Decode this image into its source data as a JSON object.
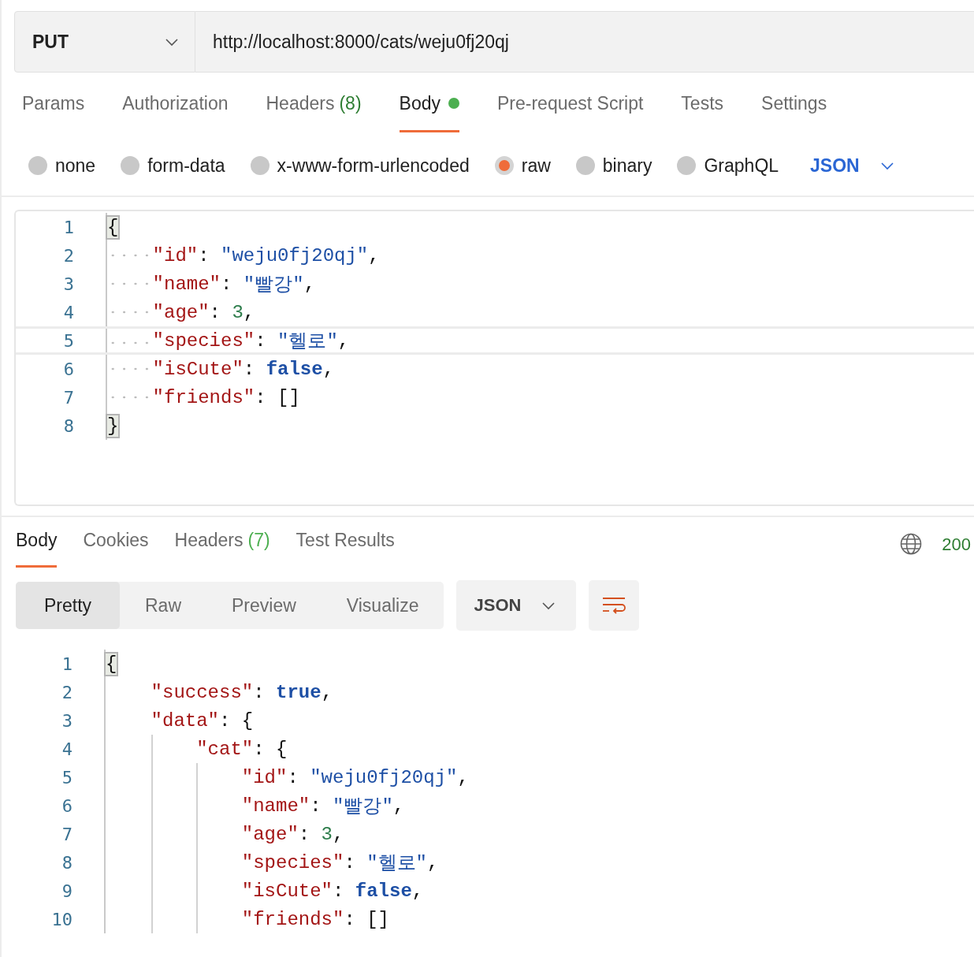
{
  "request": {
    "method": "PUT",
    "url": "http://localhost:8000/cats/weju0fj20qj",
    "tabs": [
      {
        "label": "Params",
        "selected": false,
        "indicator": false
      },
      {
        "label": "Authorization",
        "selected": false,
        "indicator": false
      },
      {
        "label": "Headers",
        "count": "(8)",
        "selected": false,
        "indicator": false
      },
      {
        "label": "Body",
        "selected": true,
        "indicator": true
      },
      {
        "label": "Pre-request Script",
        "selected": false,
        "indicator": false
      },
      {
        "label": "Tests",
        "selected": false,
        "indicator": false
      },
      {
        "label": "Settings",
        "selected": false,
        "indicator": false
      }
    ],
    "body_types": [
      {
        "label": "none",
        "selected": false
      },
      {
        "label": "form-data",
        "selected": false
      },
      {
        "label": "x-www-form-urlencoded",
        "selected": false
      },
      {
        "label": "raw",
        "selected": true
      },
      {
        "label": "binary",
        "selected": false
      },
      {
        "label": "GraphQL",
        "selected": false
      }
    ],
    "raw_format": "JSON",
    "editor": {
      "show_whitespace": true,
      "lines": [
        {
          "number": "1",
          "active": false,
          "tokens": [
            {
              "kind": "brace_match",
              "text": "{"
            }
          ],
          "children": [
            {
              "number": "2",
              "active": false,
              "tokens": [
                {
                  "kind": "key",
                  "text": "\"id\""
                },
                {
                  "kind": "punct",
                  "text": ": "
                },
                {
                  "kind": "string",
                  "text": "\"weju0fj20qj\""
                },
                {
                  "kind": "punct",
                  "text": ","
                }
              ]
            },
            {
              "number": "3",
              "active": false,
              "tokens": [
                {
                  "kind": "key",
                  "text": "\"name\""
                },
                {
                  "kind": "punct",
                  "text": ": "
                },
                {
                  "kind": "string",
                  "text": "\"빨강\""
                },
                {
                  "kind": "punct",
                  "text": ","
                }
              ]
            },
            {
              "number": "4",
              "active": false,
              "tokens": [
                {
                  "kind": "key",
                  "text": "\"age\""
                },
                {
                  "kind": "punct",
                  "text": ": "
                },
                {
                  "kind": "number",
                  "text": "3"
                },
                {
                  "kind": "punct",
                  "text": ","
                }
              ]
            },
            {
              "number": "5",
              "active": true,
              "tokens": [
                {
                  "kind": "key",
                  "text": "\"species\""
                },
                {
                  "kind": "punct",
                  "text": ": "
                },
                {
                  "kind": "string",
                  "text": "\"헬로\""
                },
                {
                  "kind": "punct",
                  "text": ","
                }
              ]
            },
            {
              "number": "6",
              "active": false,
              "tokens": [
                {
                  "kind": "key",
                  "text": "\"isCute\""
                },
                {
                  "kind": "punct",
                  "text": ": "
                },
                {
                  "kind": "bool",
                  "text": "false"
                },
                {
                  "kind": "punct",
                  "text": ","
                }
              ]
            },
            {
              "number": "7",
              "active": false,
              "tokens": [
                {
                  "kind": "key",
                  "text": "\"friends\""
                },
                {
                  "kind": "punct",
                  "text": ": "
                },
                {
                  "kind": "punct",
                  "text": "[]"
                }
              ]
            }
          ]
        },
        {
          "number": "8",
          "active": false,
          "tokens": [
            {
              "kind": "brace_match",
              "text": "}"
            }
          ]
        }
      ]
    }
  },
  "response": {
    "tabs": [
      {
        "label": "Body",
        "selected": true
      },
      {
        "label": "Cookies",
        "selected": false
      },
      {
        "label": "Headers",
        "count": "(7)",
        "selected": false
      },
      {
        "label": "Test Results",
        "selected": false
      }
    ],
    "status": "200",
    "views": [
      {
        "label": "Pretty",
        "selected": true
      },
      {
        "label": "Raw",
        "selected": false
      },
      {
        "label": "Preview",
        "selected": false
      },
      {
        "label": "Visualize",
        "selected": false
      }
    ],
    "format": "JSON",
    "editor": {
      "lines": [
        {
          "number": "1",
          "tokens": [
            {
              "kind": "brace_match",
              "text": "{"
            }
          ],
          "children": [
            {
              "number": "2",
              "tokens": [
                {
                  "kind": "key",
                  "text": "\"success\""
                },
                {
                  "kind": "punct",
                  "text": ": "
                },
                {
                  "kind": "bool",
                  "text": "true"
                },
                {
                  "kind": "punct",
                  "text": ","
                }
              ]
            },
            {
              "number": "3",
              "tokens": [
                {
                  "kind": "key",
                  "text": "\"data\""
                },
                {
                  "kind": "punct",
                  "text": ": {"
                }
              ],
              "children": [
                {
                  "number": "4",
                  "tokens": [
                    {
                      "kind": "key",
                      "text": "\"cat\""
                    },
                    {
                      "kind": "punct",
                      "text": ": {"
                    }
                  ],
                  "children": [
                    {
                      "number": "5",
                      "tokens": [
                        {
                          "kind": "key",
                          "text": "\"id\""
                        },
                        {
                          "kind": "punct",
                          "text": ": "
                        },
                        {
                          "kind": "string",
                          "text": "\"weju0fj20qj\""
                        },
                        {
                          "kind": "punct",
                          "text": ","
                        }
                      ]
                    },
                    {
                      "number": "6",
                      "tokens": [
                        {
                          "kind": "key",
                          "text": "\"name\""
                        },
                        {
                          "kind": "punct",
                          "text": ": "
                        },
                        {
                          "kind": "string",
                          "text": "\"빨강\""
                        },
                        {
                          "kind": "punct",
                          "text": ","
                        }
                      ]
                    },
                    {
                      "number": "7",
                      "tokens": [
                        {
                          "kind": "key",
                          "text": "\"age\""
                        },
                        {
                          "kind": "punct",
                          "text": ": "
                        },
                        {
                          "kind": "number",
                          "text": "3"
                        },
                        {
                          "kind": "punct",
                          "text": ","
                        }
                      ]
                    },
                    {
                      "number": "8",
                      "tokens": [
                        {
                          "kind": "key",
                          "text": "\"species\""
                        },
                        {
                          "kind": "punct",
                          "text": ": "
                        },
                        {
                          "kind": "string",
                          "text": "\"헬로\""
                        },
                        {
                          "kind": "punct",
                          "text": ","
                        }
                      ]
                    },
                    {
                      "number": "9",
                      "tokens": [
                        {
                          "kind": "key",
                          "text": "\"isCute\""
                        },
                        {
                          "kind": "punct",
                          "text": ": "
                        },
                        {
                          "kind": "bool",
                          "text": "false"
                        },
                        {
                          "kind": "punct",
                          "text": ","
                        }
                      ]
                    },
                    {
                      "number": "10",
                      "tokens": [
                        {
                          "kind": "key",
                          "text": "\"friends\""
                        },
                        {
                          "kind": "punct",
                          "text": ": "
                        },
                        {
                          "kind": "punct",
                          "text": "[]"
                        }
                      ]
                    }
                  ]
                }
              ]
            }
          ]
        }
      ]
    }
  }
}
